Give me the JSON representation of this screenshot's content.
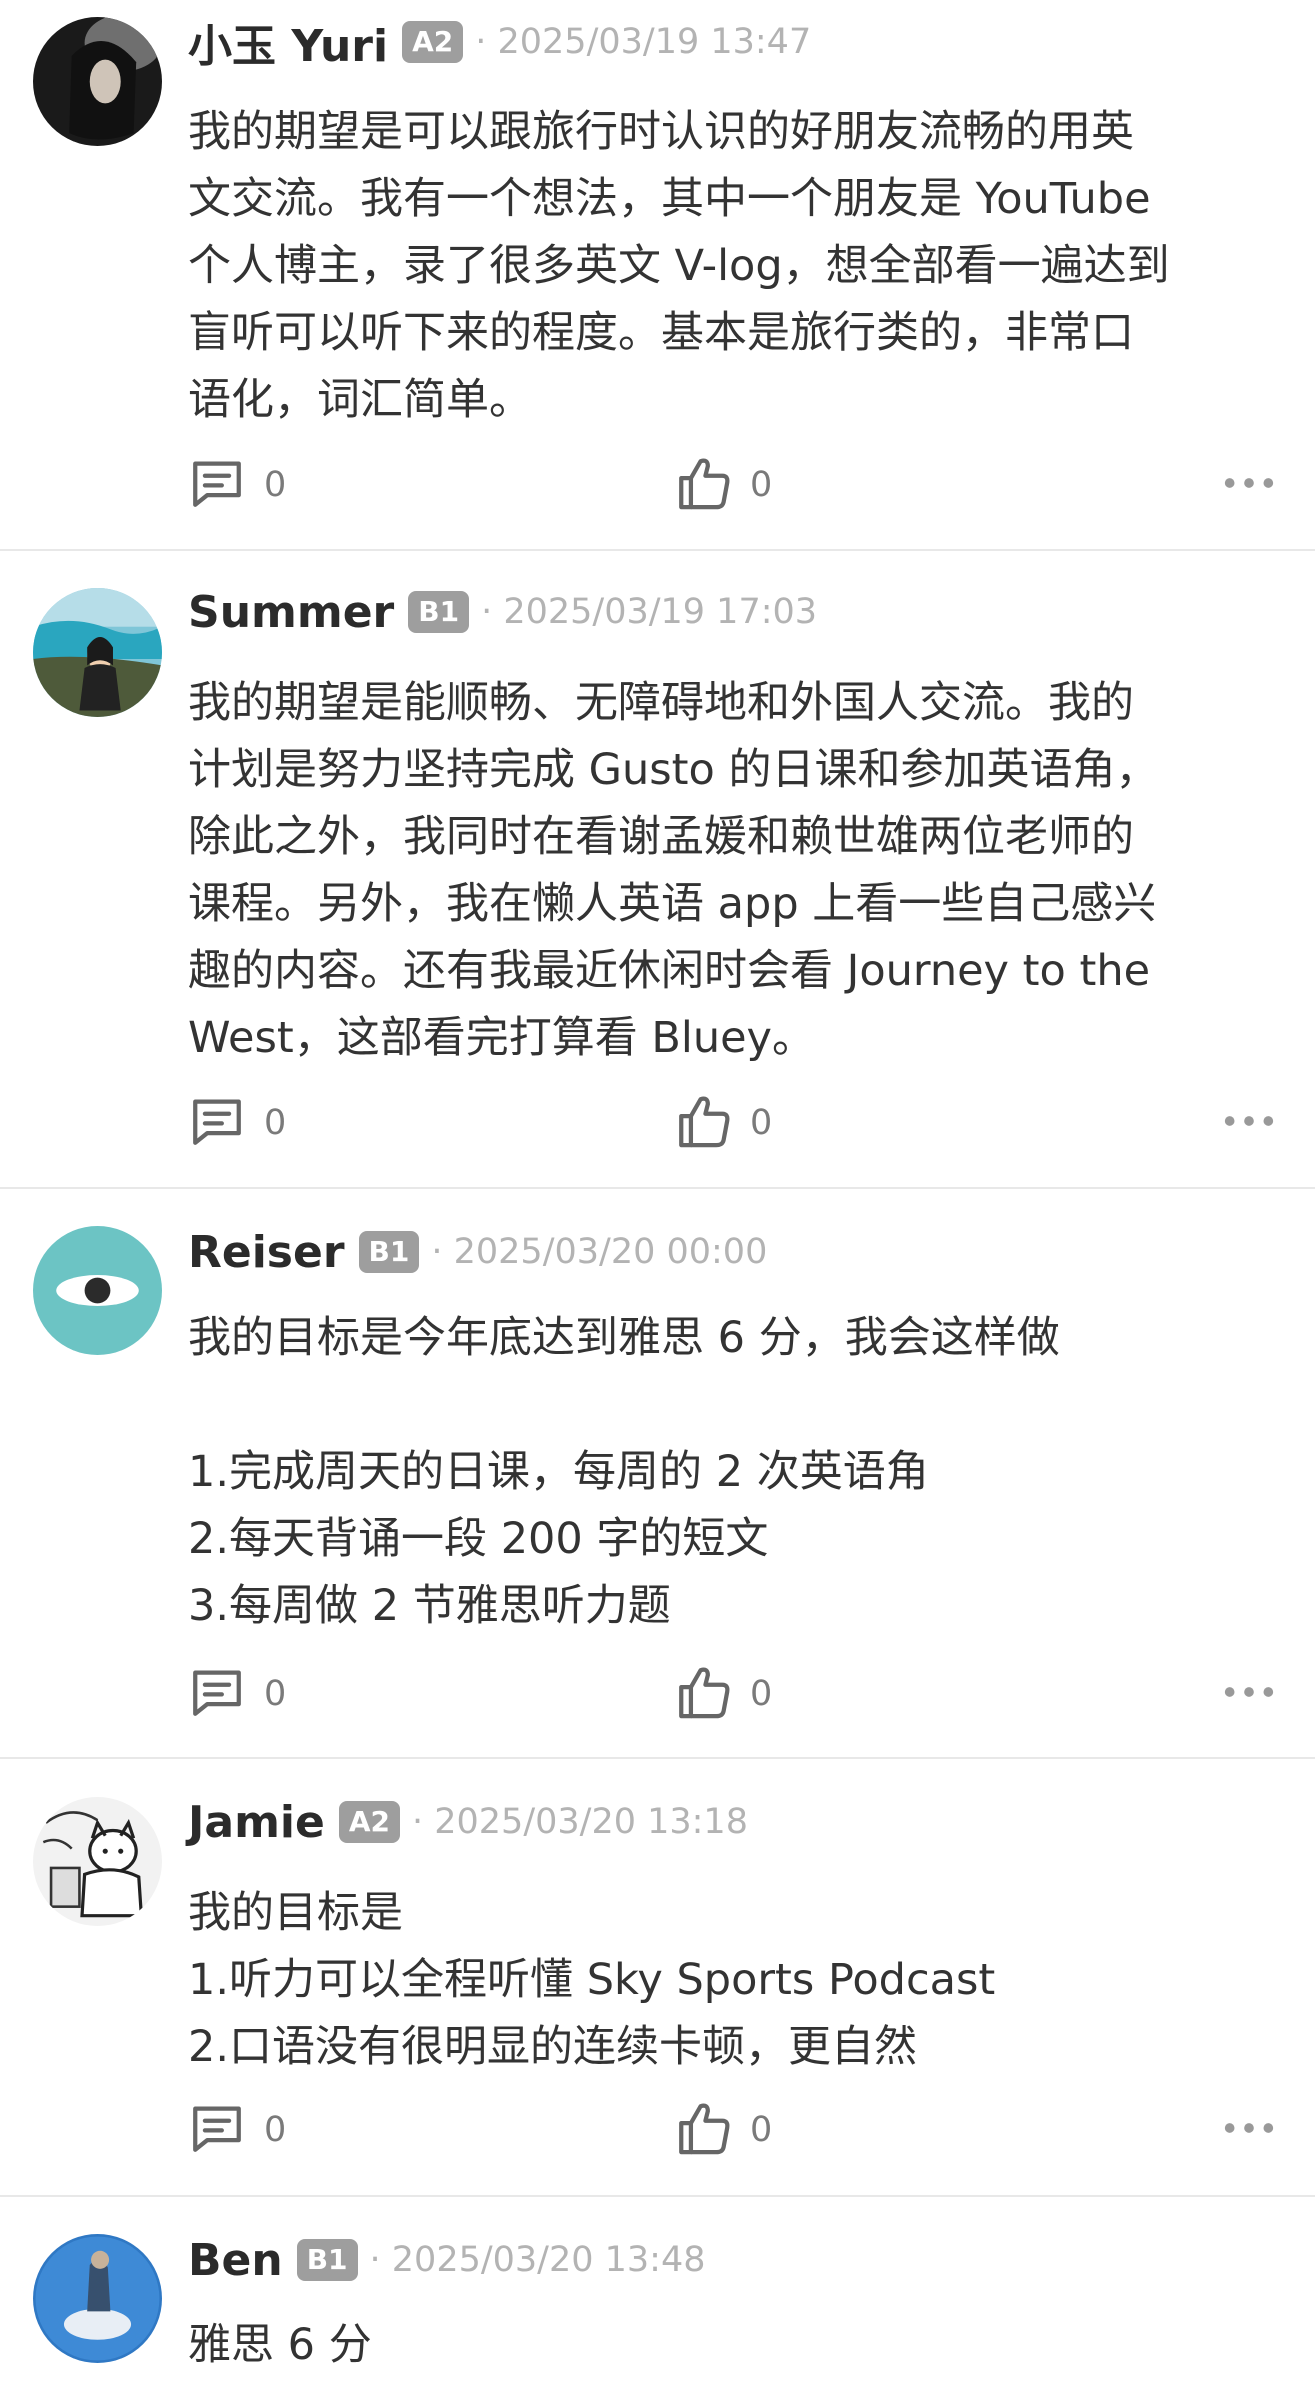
{
  "comments": [
    {
      "name": "小玉 Yuri",
      "level": "A2",
      "time": "· 2025/03/19 13:47",
      "text": "我的期望是可以跟旅行时认识的好朋友流畅的用英\n文交流。我有一个想法，其中一个朋友是 YouTube\n个人博主，录了很多英文 V-log，想全部看一遍达到\n盲听可以听下来的程度。基本是旅行类的，非常口\n语化，词汇简单。",
      "replies": "0",
      "likes": "0"
    },
    {
      "name": "Summer",
      "level": "B1",
      "time": "· 2025/03/19 17:03",
      "text": "我的期望是能顺畅、无障碍地和外国人交流。我的\n计划是努力坚持完成 Gusto 的日课和参加英语角，\n除此之外，我同时在看谢孟媛和赖世雄两位老师的\n课程。另外，我在懒人英语 app 上看一些自己感兴\n趣的内容。还有我最近休闲时会看 Journey to the\nWest，这部看完打算看 Bluey。",
      "replies": "0",
      "likes": "0"
    },
    {
      "name": "Reiser",
      "level": "B1",
      "time": "· 2025/03/20 00:00",
      "text": "我的目标是今年底达到雅思 6 分，我会这样做\n\n1.完成周天的日课，每周的 2 次英语角\n2.每天背诵一段 200 字的短文\n3.每周做 2 节雅思听力题",
      "replies": "0",
      "likes": "0"
    },
    {
      "name": "Jamie",
      "level": "A2",
      "time": "· 2025/03/20 13:18",
      "text": "我的目标是\n1.听力可以全程听懂 Sky Sports Podcast\n2.口语没有很明显的连续卡顿，更自然",
      "replies": "0",
      "likes": "0"
    },
    {
      "name": "Ben",
      "level": "B1",
      "time": "· 2025/03/20 13:48",
      "text": "雅思 6 分"
    }
  ],
  "icons": {
    "reply": "comment-icon",
    "like": "thumbs-up-icon",
    "more": "more-dots-icon"
  },
  "colors": {
    "badge": "#9e9e9e",
    "meta": "#b3b3b3",
    "icon": "#666666"
  }
}
